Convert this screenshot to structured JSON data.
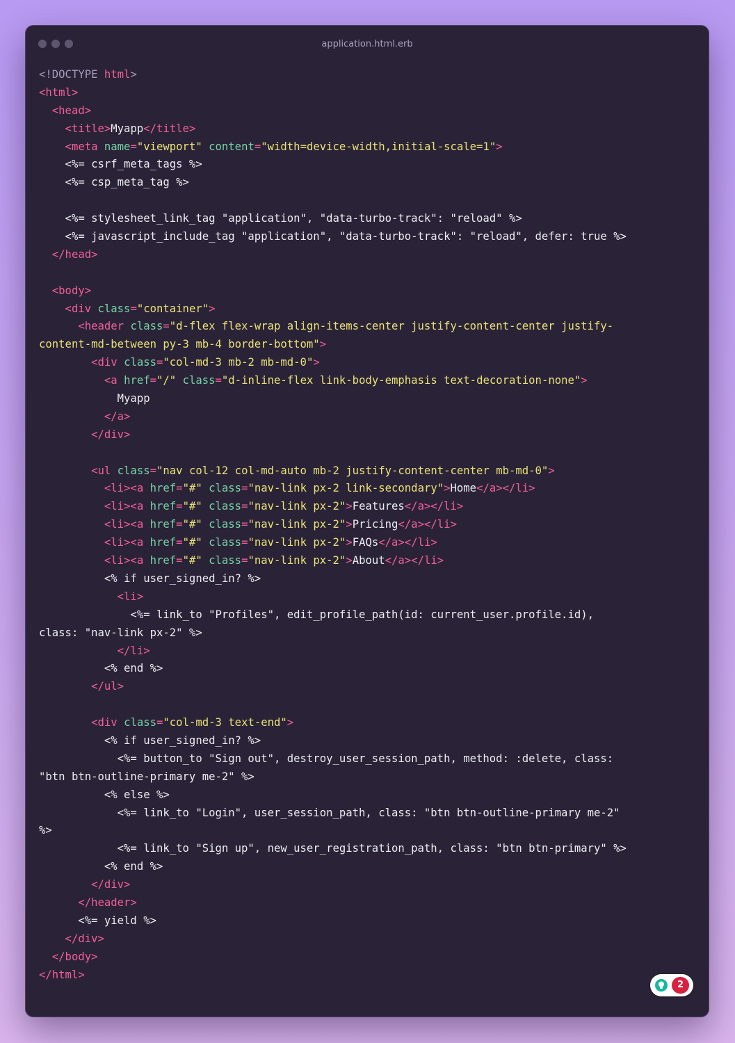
{
  "window": {
    "title": "application.html.erb"
  },
  "badge": {
    "count": "2",
    "icon": "lightbulb-icon"
  },
  "colors": {
    "tag": "#f25f9a",
    "attribute": "#76d4a6",
    "string": "#e9e177",
    "text": "#ececf2",
    "doctype": "#a59cb9",
    "window_bg": "#2a2337"
  },
  "code_lines": [
    [
      {
        "t": "<!DOCTYPE ",
        "c": "doc"
      },
      {
        "t": "html",
        "c": "tag"
      },
      {
        "t": ">",
        "c": "doc"
      }
    ],
    [
      {
        "t": "<html>",
        "c": "tag"
      }
    ],
    [
      {
        "t": "  <head>",
        "c": "tag"
      }
    ],
    [
      {
        "t": "    <title>",
        "c": "tag"
      },
      {
        "t": "Myapp",
        "c": "txt"
      },
      {
        "t": "</title>",
        "c": "tag"
      }
    ],
    [
      {
        "t": "    <meta ",
        "c": "tag"
      },
      {
        "t": "name",
        "c": "attr"
      },
      {
        "t": "=",
        "c": "tag"
      },
      {
        "t": "\"viewport\"",
        "c": "str"
      },
      {
        "t": " ",
        "c": "txt"
      },
      {
        "t": "content",
        "c": "attr"
      },
      {
        "t": "=",
        "c": "tag"
      },
      {
        "t": "\"width=device-width,initial-scale=1\"",
        "c": "str"
      },
      {
        "t": ">",
        "c": "tag"
      }
    ],
    [
      {
        "t": "    <%= csrf_meta_tags %>",
        "c": "txt"
      }
    ],
    [
      {
        "t": "    <%= csp_meta_tag %>",
        "c": "txt"
      }
    ],
    [
      {
        "t": "",
        "c": "txt"
      }
    ],
    [
      {
        "t": "    <%= stylesheet_link_tag \"application\", \"data-turbo-track\": \"reload\" %>",
        "c": "txt"
      }
    ],
    [
      {
        "t": "    <%= javascript_include_tag \"application\", \"data-turbo-track\": \"reload\", defer: true %>",
        "c": "txt"
      }
    ],
    [
      {
        "t": "  </head>",
        "c": "tag"
      }
    ],
    [
      {
        "t": "",
        "c": "txt"
      }
    ],
    [
      {
        "t": "  <body>",
        "c": "tag"
      }
    ],
    [
      {
        "t": "    <div ",
        "c": "tag"
      },
      {
        "t": "class",
        "c": "attr"
      },
      {
        "t": "=",
        "c": "tag"
      },
      {
        "t": "\"container\"",
        "c": "str"
      },
      {
        "t": ">",
        "c": "tag"
      }
    ],
    [
      {
        "t": "      <header ",
        "c": "tag"
      },
      {
        "t": "class",
        "c": "attr"
      },
      {
        "t": "=",
        "c": "tag"
      },
      {
        "t": "\"d-flex flex-wrap align-items-center justify-content-center justify-",
        "c": "str"
      }
    ],
    [
      {
        "t": "content-md-between py-3 mb-4 border-bottom\"",
        "c": "str"
      },
      {
        "t": ">",
        "c": "tag"
      }
    ],
    [
      {
        "t": "        <div ",
        "c": "tag"
      },
      {
        "t": "class",
        "c": "attr"
      },
      {
        "t": "=",
        "c": "tag"
      },
      {
        "t": "\"col-md-3 mb-2 mb-md-0\"",
        "c": "str"
      },
      {
        "t": ">",
        "c": "tag"
      }
    ],
    [
      {
        "t": "          <a ",
        "c": "tag"
      },
      {
        "t": "href",
        "c": "attr"
      },
      {
        "t": "=",
        "c": "tag"
      },
      {
        "t": "\"/\"",
        "c": "str"
      },
      {
        "t": " ",
        "c": "txt"
      },
      {
        "t": "class",
        "c": "attr"
      },
      {
        "t": "=",
        "c": "tag"
      },
      {
        "t": "\"d-inline-flex link-body-emphasis text-decoration-none\"",
        "c": "str"
      },
      {
        "t": ">",
        "c": "tag"
      }
    ],
    [
      {
        "t": "            Myapp",
        "c": "txt"
      }
    ],
    [
      {
        "t": "          </a>",
        "c": "tag"
      }
    ],
    [
      {
        "t": "        </div>",
        "c": "tag"
      }
    ],
    [
      {
        "t": "",
        "c": "txt"
      }
    ],
    [
      {
        "t": "        <ul ",
        "c": "tag"
      },
      {
        "t": "class",
        "c": "attr"
      },
      {
        "t": "=",
        "c": "tag"
      },
      {
        "t": "\"nav col-12 col-md-auto mb-2 justify-content-center mb-md-0\"",
        "c": "str"
      },
      {
        "t": ">",
        "c": "tag"
      }
    ],
    [
      {
        "t": "          <li><a ",
        "c": "tag"
      },
      {
        "t": "href",
        "c": "attr"
      },
      {
        "t": "=",
        "c": "tag"
      },
      {
        "t": "\"#\"",
        "c": "str"
      },
      {
        "t": " ",
        "c": "txt"
      },
      {
        "t": "class",
        "c": "attr"
      },
      {
        "t": "=",
        "c": "tag"
      },
      {
        "t": "\"nav-link px-2 link-secondary\"",
        "c": "str"
      },
      {
        "t": ">",
        "c": "tag"
      },
      {
        "t": "Home",
        "c": "txt"
      },
      {
        "t": "</a></li>",
        "c": "tag"
      }
    ],
    [
      {
        "t": "          <li><a ",
        "c": "tag"
      },
      {
        "t": "href",
        "c": "attr"
      },
      {
        "t": "=",
        "c": "tag"
      },
      {
        "t": "\"#\"",
        "c": "str"
      },
      {
        "t": " ",
        "c": "txt"
      },
      {
        "t": "class",
        "c": "attr"
      },
      {
        "t": "=",
        "c": "tag"
      },
      {
        "t": "\"nav-link px-2\"",
        "c": "str"
      },
      {
        "t": ">",
        "c": "tag"
      },
      {
        "t": "Features",
        "c": "txt"
      },
      {
        "t": "</a></li>",
        "c": "tag"
      }
    ],
    [
      {
        "t": "          <li><a ",
        "c": "tag"
      },
      {
        "t": "href",
        "c": "attr"
      },
      {
        "t": "=",
        "c": "tag"
      },
      {
        "t": "\"#\"",
        "c": "str"
      },
      {
        "t": " ",
        "c": "txt"
      },
      {
        "t": "class",
        "c": "attr"
      },
      {
        "t": "=",
        "c": "tag"
      },
      {
        "t": "\"nav-link px-2\"",
        "c": "str"
      },
      {
        "t": ">",
        "c": "tag"
      },
      {
        "t": "Pricing",
        "c": "txt"
      },
      {
        "t": "</a></li>",
        "c": "tag"
      }
    ],
    [
      {
        "t": "          <li><a ",
        "c": "tag"
      },
      {
        "t": "href",
        "c": "attr"
      },
      {
        "t": "=",
        "c": "tag"
      },
      {
        "t": "\"#\"",
        "c": "str"
      },
      {
        "t": " ",
        "c": "txt"
      },
      {
        "t": "class",
        "c": "attr"
      },
      {
        "t": "=",
        "c": "tag"
      },
      {
        "t": "\"nav-link px-2\"",
        "c": "str"
      },
      {
        "t": ">",
        "c": "tag"
      },
      {
        "t": "FAQs",
        "c": "txt"
      },
      {
        "t": "</a></li>",
        "c": "tag"
      }
    ],
    [
      {
        "t": "          <li><a ",
        "c": "tag"
      },
      {
        "t": "href",
        "c": "attr"
      },
      {
        "t": "=",
        "c": "tag"
      },
      {
        "t": "\"#\"",
        "c": "str"
      },
      {
        "t": " ",
        "c": "txt"
      },
      {
        "t": "class",
        "c": "attr"
      },
      {
        "t": "=",
        "c": "tag"
      },
      {
        "t": "\"nav-link px-2\"",
        "c": "str"
      },
      {
        "t": ">",
        "c": "tag"
      },
      {
        "t": "About",
        "c": "txt"
      },
      {
        "t": "</a></li>",
        "c": "tag"
      }
    ],
    [
      {
        "t": "          <% if user_signed_in? %>",
        "c": "txt"
      }
    ],
    [
      {
        "t": "            <li>",
        "c": "tag"
      }
    ],
    [
      {
        "t": "              <%= link_to \"Profiles\", edit_profile_path(id: current_user.profile.id),",
        "c": "txt"
      }
    ],
    [
      {
        "t": "class: \"nav-link px-2\" %>",
        "c": "txt"
      }
    ],
    [
      {
        "t": "            </li>",
        "c": "tag"
      }
    ],
    [
      {
        "t": "          <% end %>",
        "c": "txt"
      }
    ],
    [
      {
        "t": "        </ul>",
        "c": "tag"
      }
    ],
    [
      {
        "t": "",
        "c": "txt"
      }
    ],
    [
      {
        "t": "        <div ",
        "c": "tag"
      },
      {
        "t": "class",
        "c": "attr"
      },
      {
        "t": "=",
        "c": "tag"
      },
      {
        "t": "\"col-md-3 text-end\"",
        "c": "str"
      },
      {
        "t": ">",
        "c": "tag"
      }
    ],
    [
      {
        "t": "          <% if user_signed_in? %>",
        "c": "txt"
      }
    ],
    [
      {
        "t": "            <%= button_to \"Sign out\", destroy_user_session_path, method: :delete, class:",
        "c": "txt"
      }
    ],
    [
      {
        "t": "\"btn btn-outline-primary me-2\" %>",
        "c": "txt"
      }
    ],
    [
      {
        "t": "          <% else %>",
        "c": "txt"
      }
    ],
    [
      {
        "t": "            <%= link_to \"Login\", user_session_path, class: \"btn btn-outline-primary me-2\"",
        "c": "txt"
      }
    ],
    [
      {
        "t": "%>",
        "c": "txt"
      }
    ],
    [
      {
        "t": "            <%= link_to \"Sign up\", new_user_registration_path, class: \"btn btn-primary\" %>",
        "c": "txt"
      }
    ],
    [
      {
        "t": "          <% end %>",
        "c": "txt"
      }
    ],
    [
      {
        "t": "        </div>",
        "c": "tag"
      }
    ],
    [
      {
        "t": "      </header>",
        "c": "tag"
      }
    ],
    [
      {
        "t": "      <%= yield %>",
        "c": "txt"
      }
    ],
    [
      {
        "t": "    </div>",
        "c": "tag"
      }
    ],
    [
      {
        "t": "  </body>",
        "c": "tag"
      }
    ],
    [
      {
        "t": "</html>",
        "c": "tag"
      }
    ]
  ]
}
